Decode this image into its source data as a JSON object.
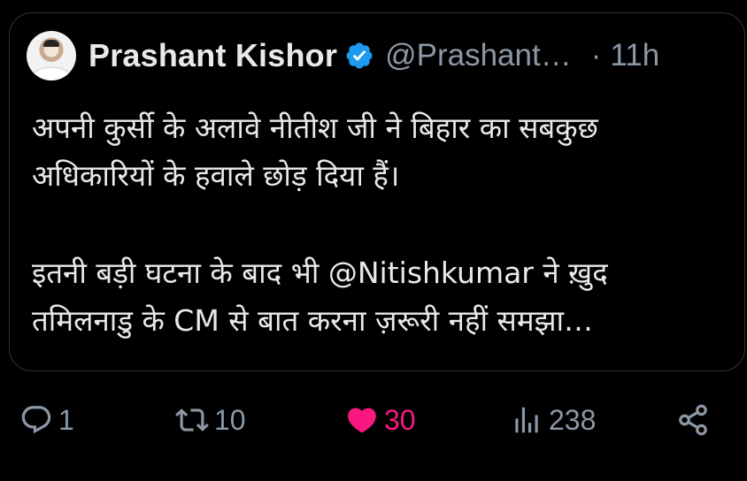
{
  "tweet": {
    "author": {
      "display_name": "Prashant Kishor",
      "handle": "@Prashant…",
      "verified_icon": "verified-badge-icon",
      "avatar_icon": "avatar"
    },
    "separator": "·",
    "timestamp": "11h",
    "text_lines": [
      "अपनी कुर्सी के अलावे नीतीश जी ने बिहार का सबकुछ",
      "अधिकारियों के हवाले छोड़ दिया हैं।",
      "इतनी बड़ी घटना के बाद भी @Nitishkumar ने ख़ुद",
      "तमिलनाडु के CM से बात करना ज़रूरी नहीं समझा…"
    ]
  },
  "actions": {
    "reply": {
      "icon": "reply-icon",
      "count": "1"
    },
    "retweet": {
      "icon": "retweet-icon",
      "count": "10"
    },
    "like": {
      "icon": "heart-icon",
      "count": "30"
    },
    "views": {
      "icon": "views-icon",
      "count": "238"
    },
    "share": {
      "icon": "share-icon"
    }
  },
  "colors": {
    "background": "#000000",
    "text": "#e7e9ea",
    "muted": "#8b98a5",
    "verified": "#1d9bf0",
    "like": "#f91880",
    "border": "#2f3336"
  }
}
